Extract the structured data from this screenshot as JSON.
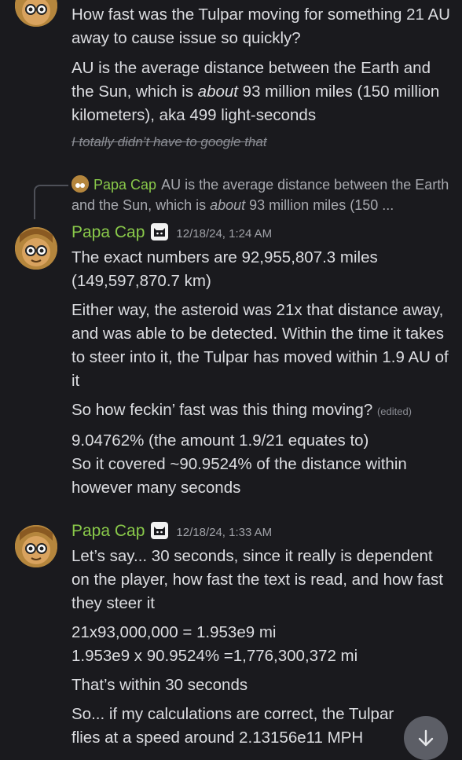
{
  "messages": [
    {
      "lines": [
        "How fast was the Tulpar moving for something 21 AU away to cause issue so quickly?"
      ],
      "para2_pre": "AU is the average distance between the Earth and the Sun, which is ",
      "para2_em": "about",
      "para2_post": " 93 million miles (150 million kilometers), aka 499 light-seconds",
      "strike": "I totally didn’t have to google that"
    }
  ],
  "reply": {
    "name": "Papa Cap",
    "pre": "AU is the average distance between the Earth and the Sun, which is ",
    "em": "about",
    "post": " 93 million miles (150 ..."
  },
  "msg2": {
    "name": "Papa Cap",
    "timestamp": "12/18/24, 1:24 AM",
    "p1": "The exact numbers are 92,955,807.3 miles (149,597,870.7 km)",
    "p2": "Either way, the asteroid was 21x that distance away, and was able to be detected. Within the time it takes to steer into it, the Tulpar has moved within 1.9 AU of it",
    "p3": "So how feckin’ fast was this thing moving?",
    "edited": "(edited)",
    "p4a": "9.04762% (the amount 1.9/21 equates to)",
    "p4b": "So it covered ~90.9524% of the distance within however many seconds"
  },
  "msg3": {
    "name": "Papa Cap",
    "timestamp": "12/18/24, 1:33 AM",
    "p1": "Let’s say... 30 seconds, since it really is dependent on the player, how fast the text is read, and how fast they steer it",
    "p2a": "21x93,000,000 = 1.953e9 mi",
    "p2b": "1.953e9 x 90.9524% =1,776,300,372 mi",
    "p3": "That’s within 30 seconds",
    "p4": "So... if my calculations are correct, the Tulpar flies at a speed around 2.13156e11 MPH"
  },
  "colors": {
    "username": "#89c94a",
    "background": "#1a1a1e",
    "text": "#dcdde1"
  },
  "icons": {
    "scroll": "arrow-down-icon",
    "badge": "cat-badge-icon"
  }
}
